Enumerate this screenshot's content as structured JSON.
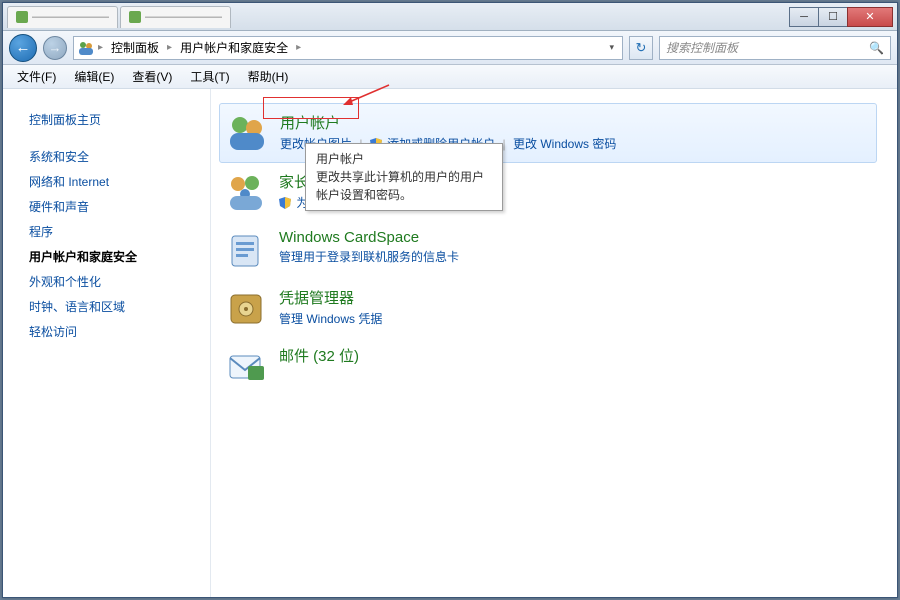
{
  "titlebar": {
    "tab1": "———————",
    "tab2": "———————"
  },
  "breadcrumb": {
    "level1": "控制面板",
    "level2": "用户帐户和家庭安全"
  },
  "search": {
    "placeholder": "搜索控制面板"
  },
  "menu": {
    "file": "文件(F)",
    "edit": "编辑(E)",
    "view": "查看(V)",
    "tools": "工具(T)",
    "help": "帮助(H)"
  },
  "sidebar": {
    "items": [
      {
        "label": "控制面板主页"
      },
      {
        "label": "系统和安全"
      },
      {
        "label": "网络和 Internet"
      },
      {
        "label": "硬件和声音"
      },
      {
        "label": "程序"
      },
      {
        "label": "用户帐户和家庭安全"
      },
      {
        "label": "外观和个性化"
      },
      {
        "label": "时钟、语言和区域"
      },
      {
        "label": "轻松访问"
      }
    ]
  },
  "categories": {
    "user_accounts": {
      "title": "用户帐户",
      "link1": "更改帐户图片",
      "link2": "添加或删除用户帐户",
      "link3": "更改 Windows 密码"
    },
    "parental": {
      "title": "家长",
      "link1": "为所"
    },
    "cardspace": {
      "title": "Windows CardSpace",
      "link1": "管理用于登录到联机服务的信息卡"
    },
    "credential": {
      "title": "凭据管理器",
      "link1": "管理 Windows 凭据"
    },
    "mail": {
      "title": "邮件 (32 位)"
    }
  },
  "tooltip": {
    "title": "用户帐户",
    "body": "更改共享此计算机的用户的用户帐户设置和密码。"
  }
}
